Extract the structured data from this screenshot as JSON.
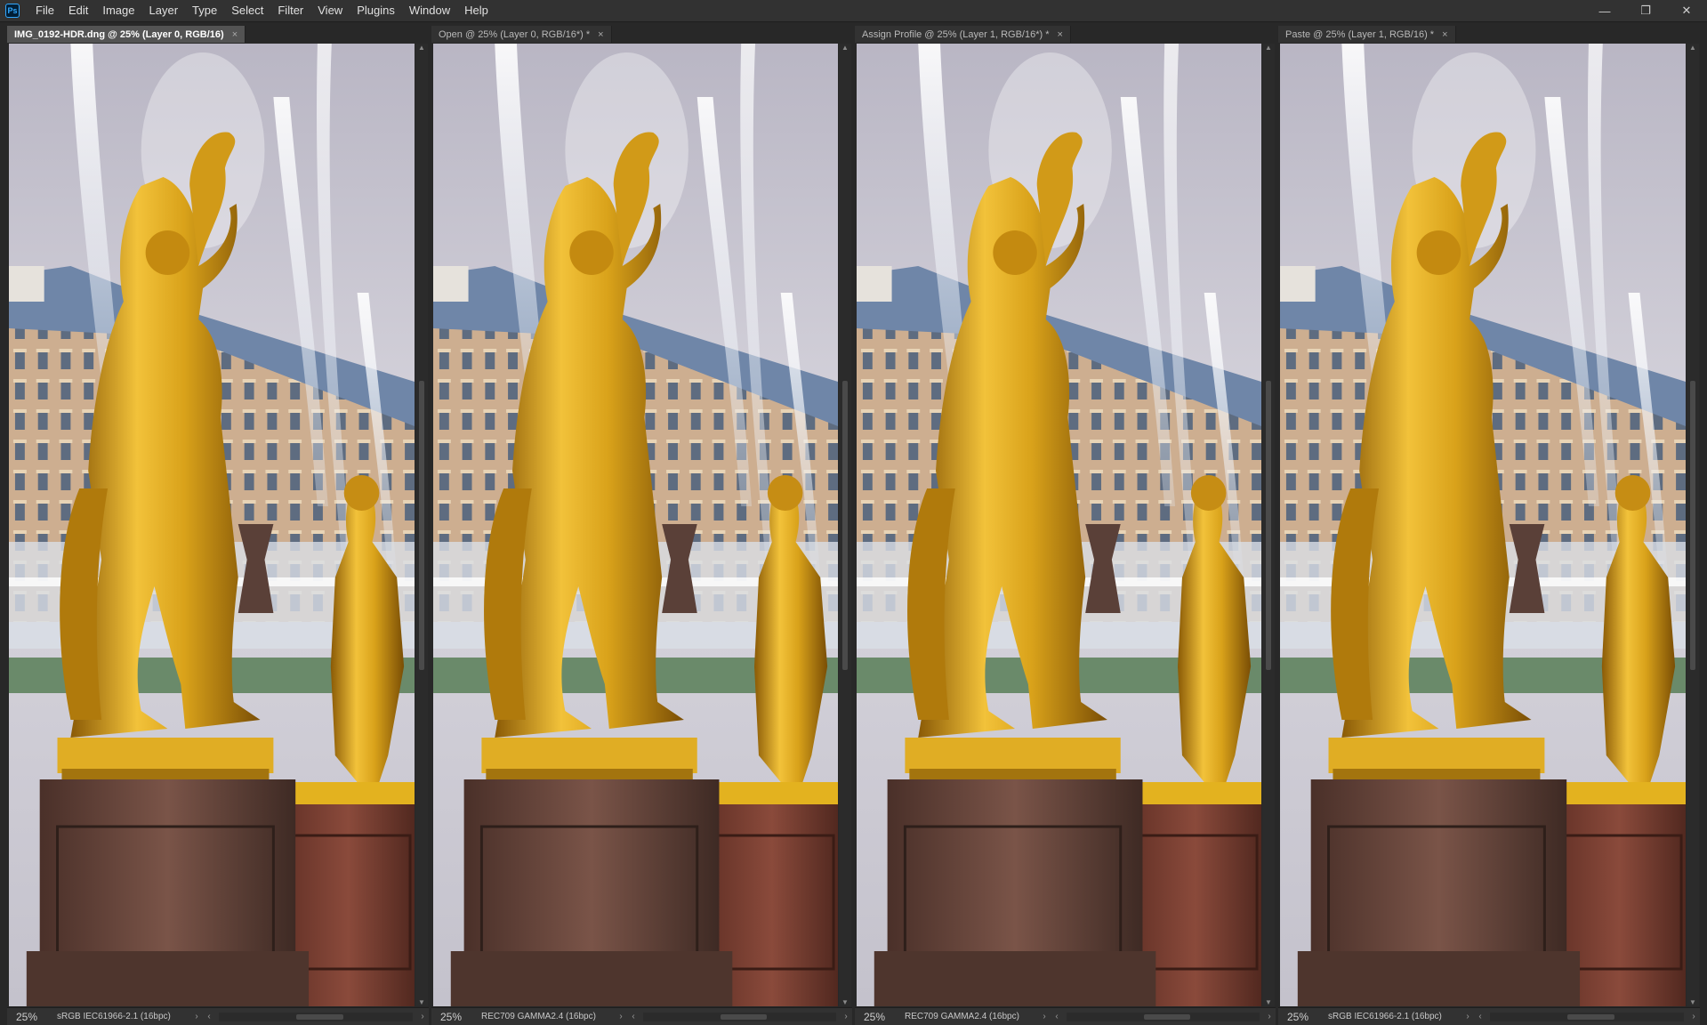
{
  "app": {
    "logo_text": "Ps"
  },
  "menu": [
    "File",
    "Edit",
    "Image",
    "Layer",
    "Type",
    "Select",
    "Filter",
    "View",
    "Plugins",
    "Window",
    "Help"
  ],
  "window_controls": {
    "minimize": "—",
    "restore": "❐",
    "close": "✕"
  },
  "documents": [
    {
      "tab_title": "IMG_0192-HDR.dng @ 25% (Layer 0, RGB/16)",
      "active": true,
      "zoom": "25%",
      "profile": "sRGB IEC61966-2.1 (16bpc)"
    },
    {
      "tab_title": "Open @ 25% (Layer 0, RGB/16*) *",
      "active": false,
      "zoom": "25%",
      "profile": "REC709 GAMMA2.4 (16bpc)"
    },
    {
      "tab_title": "Assign Profile @ 25% (Layer 1, RGB/16*) *",
      "active": false,
      "zoom": "25%",
      "profile": "REC709 GAMMA2.4 (16bpc)"
    },
    {
      "tab_title": "Paste @ 25% (Layer 1, RGB/16) *",
      "active": false,
      "zoom": "25%",
      "profile": "sRGB IEC61966-2.1 (16bpc)"
    }
  ],
  "icons": {
    "close_tab": "×",
    "arrow_right": "›",
    "arrow_left": "‹",
    "arrow_up": "▲",
    "arrow_down": "▼"
  },
  "colors": {
    "sky": "#c9c7d2",
    "gold": "#d9a21a",
    "gold_dark": "#8a5a06",
    "granite": "#6e4c43",
    "granite_dark": "#3e2a24",
    "palace_blue": "#6f86a8",
    "palace_facade": "#c9a98c"
  }
}
